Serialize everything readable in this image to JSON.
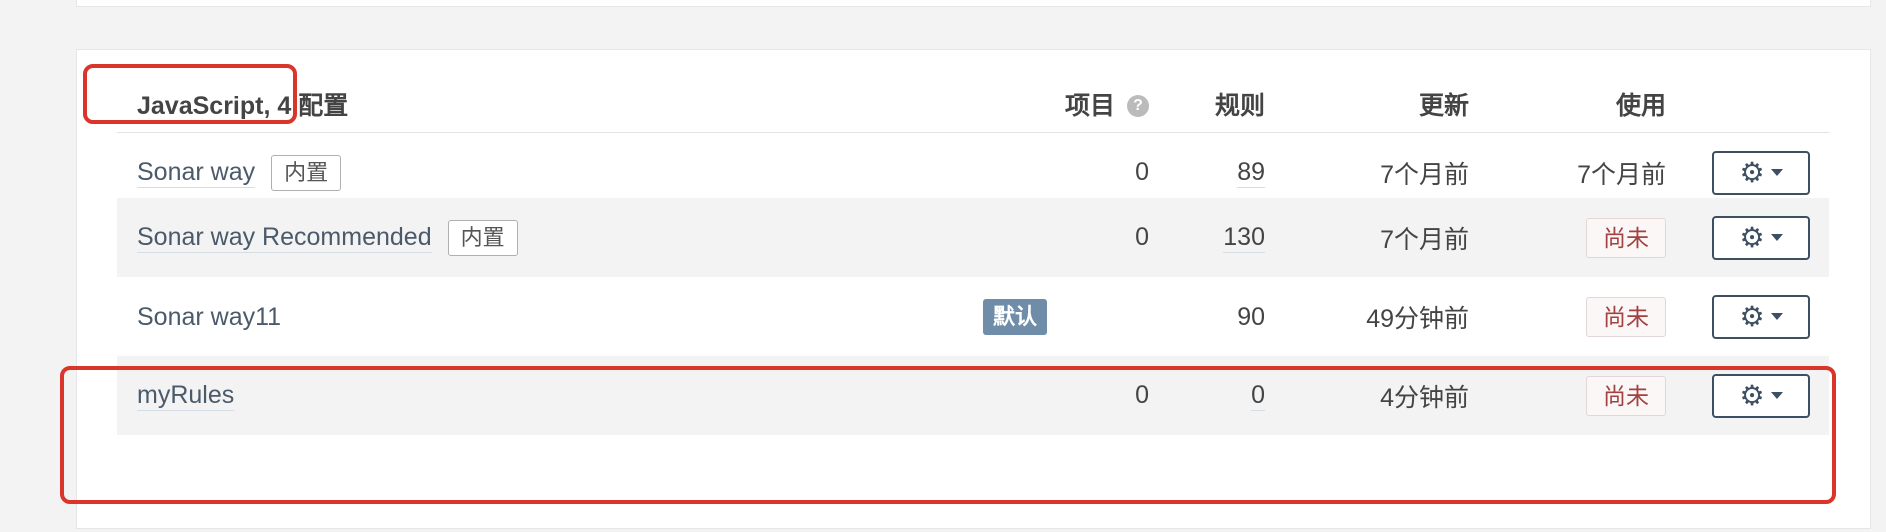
{
  "header": {
    "title": "JavaScript, 4 配置",
    "projects": "项目",
    "rules": "规则",
    "updated": "更新",
    "used": "使用"
  },
  "help_icon": "question-circle-icon",
  "profiles": [
    {
      "name": "Sonar way",
      "builtin": "内置",
      "default": "",
      "projects": "0",
      "rules": "89",
      "updated": "7个月前",
      "used": "7个月前",
      "used_never": false
    },
    {
      "name": "Sonar way Recommended",
      "builtin": "内置",
      "default": "",
      "projects": "0",
      "rules": "130",
      "updated": "7个月前",
      "used": "尚未",
      "used_never": true
    },
    {
      "name": "Sonar way11",
      "builtin": "",
      "default": "默认",
      "projects": "",
      "rules": "90",
      "updated": "49分钟前",
      "used": "尚未",
      "used_never": true
    },
    {
      "name": "myRules",
      "builtin": "",
      "default": "",
      "projects": "0",
      "rules": "0",
      "updated": "4分钟前",
      "used": "尚未",
      "used_never": true
    }
  ],
  "actions_icon": "gear-icon",
  "colors": {
    "annotation": "#d9352b",
    "default_badge": "#6f8ca8",
    "never_text": "#a34040",
    "button_border": "#3d4f62"
  }
}
